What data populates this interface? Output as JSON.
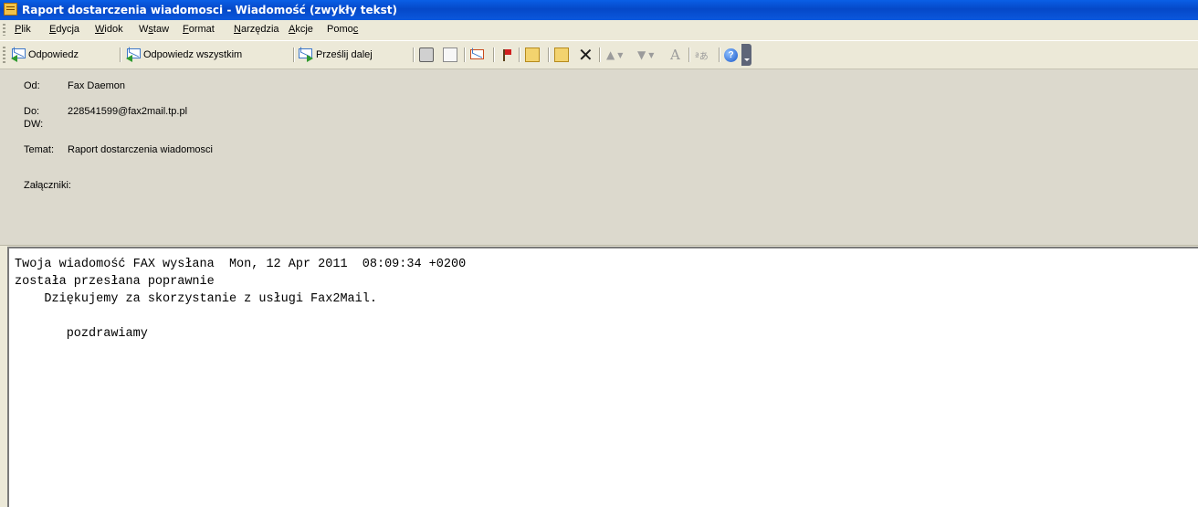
{
  "window": {
    "title": "Raport dostarczenia wiadomosci - Wiadomość (zwykły tekst)"
  },
  "menu": [
    {
      "mn": "P",
      "rest": "lik"
    },
    {
      "mn": "E",
      "rest": "dycja"
    },
    {
      "mn": "W",
      "rest": "idok"
    },
    {
      "pre": "W",
      "mn": "s",
      "rest": "taw"
    },
    {
      "mn": "F",
      "rest": "ormat"
    },
    {
      "mn": "N",
      "rest": "arzędzia"
    },
    {
      "mn": "A",
      "rest": "kcje"
    },
    {
      "pre": "Pomo",
      "mn": "c",
      "rest": ""
    }
  ],
  "toolbar": {
    "reply_label": "Odpowiedz",
    "reply_all_label": "Odpowiedz wszystkim",
    "forward_label": "Prześlij dalej",
    "font_size_glyph": "A",
    "help_glyph": "?"
  },
  "header": {
    "from_label": "Od:",
    "from_value": "Fax Daemon",
    "to_label": "Do:",
    "to_value": "228541599@fax2mail.tp.pl",
    "cc_label": "DW:",
    "cc_value": "",
    "subject_label": "Temat:",
    "subject_value": "Raport dostarczenia wiadomosci",
    "attachments_label": "Załączniki:"
  },
  "body": {
    "lines": [
      "Twoja wiadomość FAX wysłana  Mon, 12 Apr 2011  08:09:34 +0200",
      "została przesłana poprawnie",
      "    Dziękujemy za skorzystanie z usługi Fax2Mail.",
      "",
      "       pozdrawiamy"
    ]
  }
}
